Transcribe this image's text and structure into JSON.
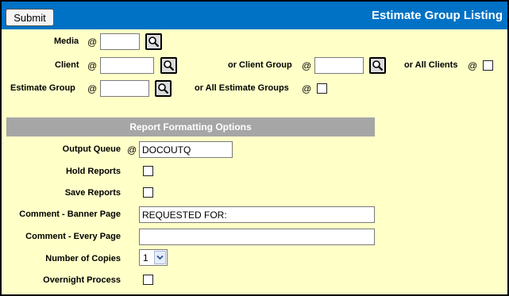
{
  "header": {
    "submit_label": "Submit",
    "title": "Estimate Group Listing"
  },
  "at_sign": "@",
  "selection": {
    "media_label": "Media",
    "client_label": "Client",
    "client_group_label": "or Client Group",
    "all_clients_label": "or All Clients",
    "estimate_group_label": "Estimate Group",
    "all_estimate_groups_label": "or All Estimate Groups",
    "media_value": "",
    "client_value": "",
    "client_group_value": "",
    "estimate_group_value": "",
    "all_clients_checked": false,
    "all_estimate_groups_checked": false
  },
  "report": {
    "section_title": "Report Formatting Options",
    "output_queue_label": "Output Queue",
    "output_queue_value": "DOCOUTQ",
    "hold_reports_label": "Hold Reports",
    "save_reports_label": "Save Reports",
    "comment_banner_label": "Comment - Banner Page",
    "comment_banner_value": "REQUESTED FOR:",
    "comment_every_label": "Comment - Every Page",
    "comment_every_value": "",
    "copies_label": "Number of Copies",
    "copies_value": "1",
    "overnight_label": "Overnight Process",
    "hold_reports_checked": false,
    "save_reports_checked": false,
    "overnight_checked": false
  },
  "icons": {
    "lookup": "magnifier-icon",
    "dropdown": "chevron-down-icon"
  },
  "colors": {
    "header": "#0072c6",
    "background": "#ffffc8",
    "section": "#a6a6a6"
  }
}
